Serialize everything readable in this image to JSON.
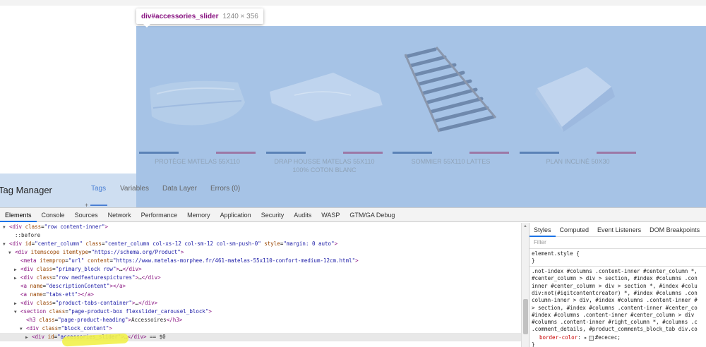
{
  "tooltip": {
    "element": "div#accessories_slider",
    "size": "1240 × 356"
  },
  "products": [
    {
      "name": "PROTÈGE MATELAS 55X110",
      "image": "mattress-protector-image"
    },
    {
      "name": "DRAP HOUSSE MATELAS 55X110 100% COTON BLANC",
      "image": "fitted-sheet-image"
    },
    {
      "name": "SOMMIER 55X110 LATTES",
      "image": "slatted-base-image"
    },
    {
      "name": "PLAN INCLINÉ 50X30",
      "image": "incline-wedge-image"
    }
  ],
  "tag_manager": {
    "title": "Tag Manager",
    "tabs": [
      "Tags",
      "Variables",
      "Data Layer",
      "Errors (0)"
    ],
    "active_tab": "Tags",
    "handle": "+"
  },
  "devtools": {
    "tabs": [
      "Elements",
      "Console",
      "Sources",
      "Network",
      "Performance",
      "Memory",
      "Application",
      "Security",
      "Audits",
      "WASP",
      "GTM/GA Debug"
    ],
    "active_tab": "Elements",
    "dom_lines": [
      {
        "indent": 0,
        "tri": "▼",
        "html": "<span class='tag'>&lt;div</span> <span class='attr'>class</span>=<span class='val'>\"row content-inner\"</span><span class='tag'>&gt;</span>"
      },
      {
        "indent": 1,
        "tri": "",
        "html": "<span class='txt'>::before</span>"
      },
      {
        "indent": 0,
        "tri": "▼",
        "html": "<span class='tag'>&lt;div</span> <span class='attr'>id</span>=<span class='val'>\"center_column\"</span> <span class='attr'>class</span>=<span class='val'>\"center_column col-xs-12 col-sm-12 col-sm-push-0\"</span> <span class='attr'>style</span>=<span class='val'>\"margin: 0 auto\"</span><span class='tag'>&gt;</span>"
      },
      {
        "indent": 1,
        "tri": "▼",
        "html": "<span class='tag'>&lt;div</span> <span class='attr'>itemscope itemtype</span>=<span class='val'>\"https://schema.org/Product\"</span><span class='tag'>&gt;</span>"
      },
      {
        "indent": 2,
        "tri": "",
        "html": "<span class='tag'>&lt;meta</span> <span class='attr'>itemprop</span>=<span class='val'>\"url\"</span> <span class='attr'>content</span>=<span class='val'>\"https://www.matelas-morphee.fr/461-matelas-55x110-confort-medium-12cm.html\"</span><span class='tag'>&gt;</span>"
      },
      {
        "indent": 2,
        "tri": "▶",
        "html": "<span class='tag'>&lt;div</span> <span class='attr'>class</span>=<span class='val'>\"primary_block row\"</span><span class='tag'>&gt;</span>…<span class='tag'>&lt;/div&gt;</span>"
      },
      {
        "indent": 2,
        "tri": "▶",
        "html": "<span class='tag'>&lt;div</span> <span class='attr'>class</span>=<span class='val'>\"row medfeaturespictures\"</span><span class='tag'>&gt;</span>…<span class='tag'>&lt;/div&gt;</span>"
      },
      {
        "indent": 2,
        "tri": "",
        "html": "<span class='tag'>&lt;a</span> <span class='attr'>name</span>=<span class='val'>\"descriptionContent\"</span><span class='tag'>&gt;&lt;/a&gt;</span>"
      },
      {
        "indent": 2,
        "tri": "",
        "html": "<span class='tag'>&lt;a</span> <span class='attr'>name</span>=<span class='val'>\"tabs-ett\"</span><span class='tag'>&gt;&lt;/a&gt;</span>"
      },
      {
        "indent": 2,
        "tri": "▶",
        "html": "<span class='tag'>&lt;div</span> <span class='attr'>class</span>=<span class='val'>\"product-tabs-container\"</span><span class='tag'>&gt;</span>…<span class='tag'>&lt;/div&gt;</span>"
      },
      {
        "indent": 2,
        "tri": "▼",
        "html": "<span class='tag'>&lt;section</span> <span class='attr'>class</span>=<span class='val'>\"page-product-box flexslider_carousel_block\"</span><span class='tag'>&gt;</span>"
      },
      {
        "indent": 3,
        "tri": "",
        "html": "<span class='tag'>&lt;h3</span> <span class='attr'>class</span>=<span class='val'>\"page-product-heading\"</span><span class='tag'>&gt;</span><span class='txt'>Accessoires</span><span class='tag'>&lt;/h3&gt;</span>"
      },
      {
        "indent": 3,
        "tri": "▼",
        "html": "<span class='tag'>&lt;div</span> <span class='attr'>class</span>=<span class='val'>\"block_content\"</span><span class='tag'>&gt;</span>"
      },
      {
        "indent": 4,
        "tri": "▶",
        "html": "<span class='tag'>&lt;div</span> <span class='attr'>id</span>=<span class='val'>\"accessories_slider\"</span><span class='tag'>&gt;</span>…<span class='tag'>&lt;/div&gt;</span> <span class='txt'>== $0</span>",
        "selected": true
      }
    ]
  },
  "styles": {
    "tabs": [
      "Styles",
      "Computed",
      "Event Listeners",
      "DOM Breakpoints"
    ],
    "active_tab": "Styles",
    "filter_placeholder": "Filter",
    "element_style": "element.style {",
    "close_brace": "}",
    "rule_lines": [
      ".not-index #columns .content-inner #center_column *,",
      "#center_column > div > section, #index #columns .con",
      "inner #center_column > div > section *, #index #colu",
      "div:not(#iqitcontentcreator) *, #index #columns .con",
      "column-inner > div, #index #columns .content-inner #",
      "> section, #index #columns .content-inner #center_co",
      "#index #columns .content-inner #center_column > div",
      "#columns .content-inner #right_column *, #columns .c",
      ".comment_details, #product_comments_block_tab div.co"
    ],
    "border_prop": "border-color",
    "border_value": "#ececec;"
  },
  "colors": {
    "highlight": "#a6c3e6",
    "accent": "#1a73e8",
    "tag": "#881280"
  }
}
